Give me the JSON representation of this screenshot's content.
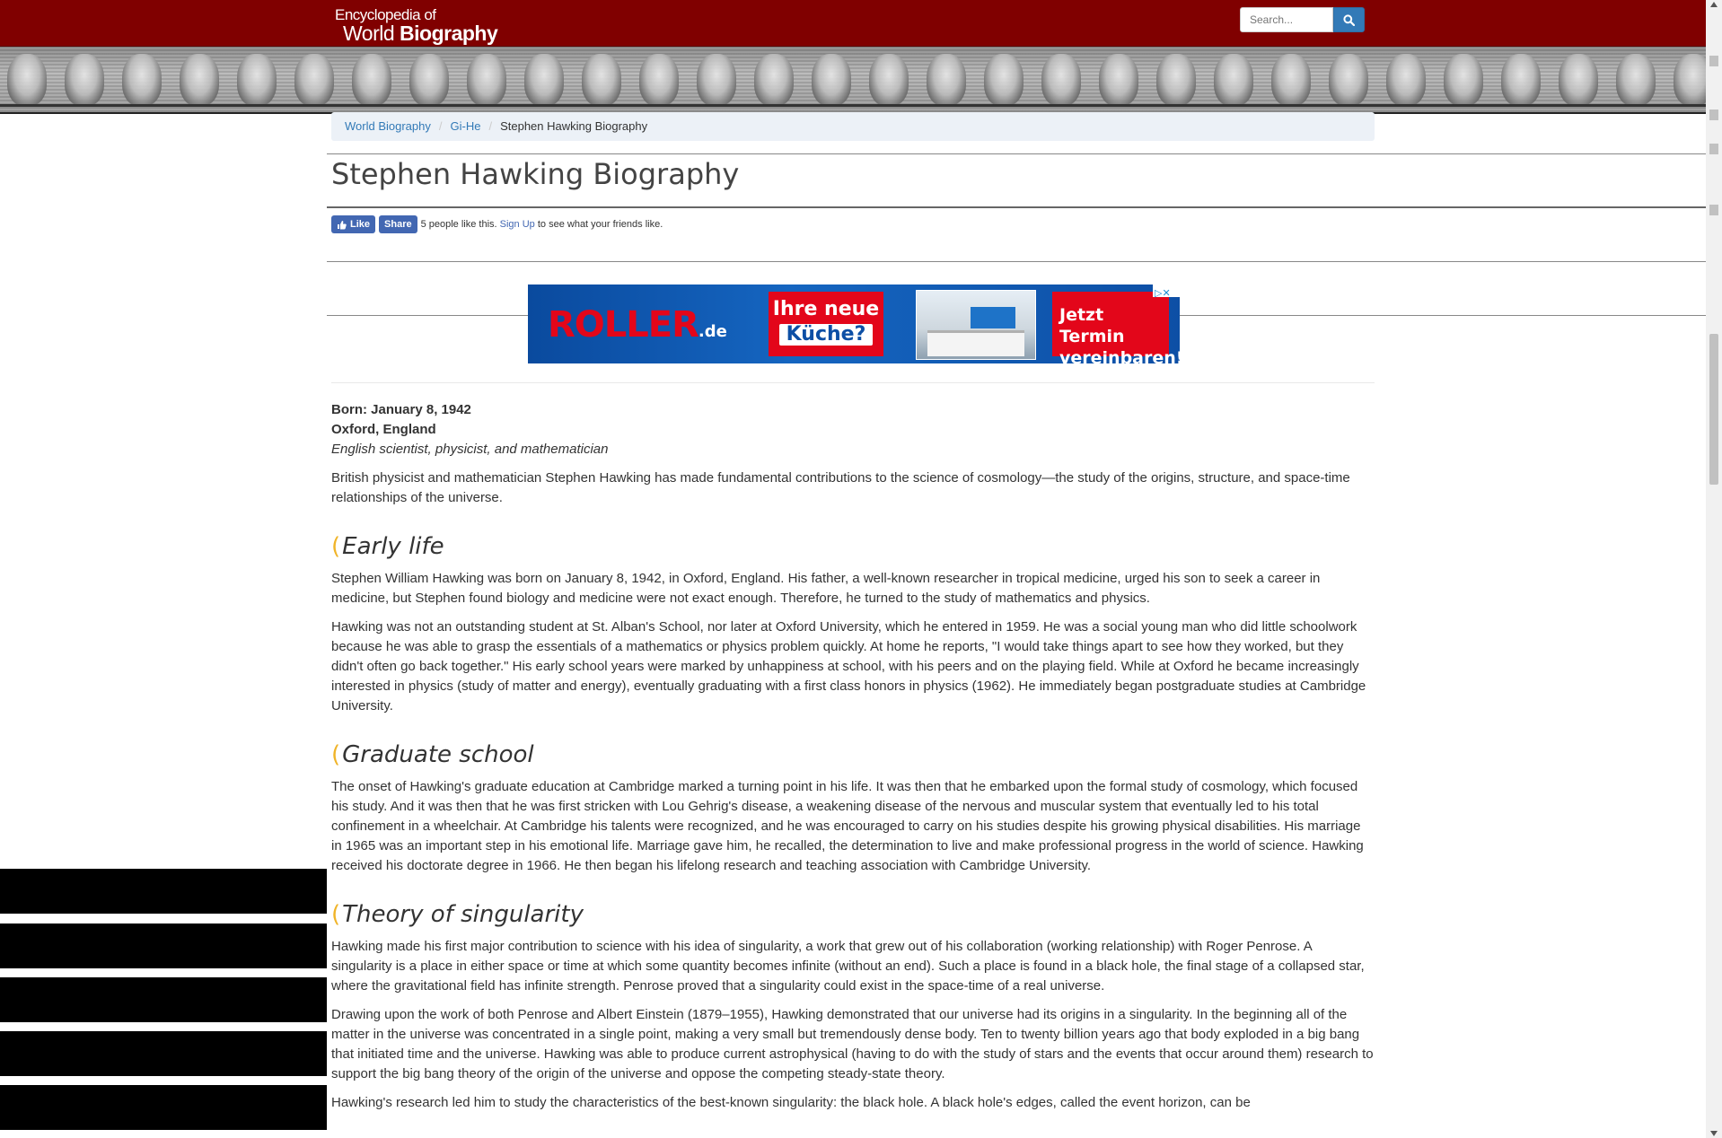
{
  "header": {
    "logo_line1": "Encyclopedia of",
    "logo_line2_a": "World ",
    "logo_line2_b": "Biography",
    "search_placeholder": "Search...",
    "colors": {
      "bar": "#800000",
      "search_button": "#337ab7"
    }
  },
  "breadcrumb": {
    "items": [
      "World Biography",
      "Gi-He"
    ],
    "current": "Stephen Hawking Biography"
  },
  "page": {
    "title": "Stephen Hawking Biography"
  },
  "facebook": {
    "like": "Like",
    "share": "Share",
    "count_text": "5 people like this.",
    "signup": "Sign Up",
    "signup_suffix": "to see what your friends like."
  },
  "ad": {
    "brand": "ROLLER",
    "brand_tld": ".de",
    "promo_line1": "Ihre neue",
    "promo_line2": "Küche?",
    "cta_line1": "Jetzt Termin",
    "cta_line2": "vereinbaren!"
  },
  "article": {
    "born": "Born: January 8, 1942",
    "birthplace": "Oxford, England",
    "role": "English scientist, physicist, and mathematician",
    "intro": "British physicist and mathematician Stephen Hawking has made fundamental contributions to the science of cosmology—the study of the origins, structure, and space-time relationships of the universe.",
    "sections": [
      {
        "heading": "Early life",
        "paragraphs": [
          "Stephen William Hawking was born on January 8, 1942, in Oxford, England. His father, a well-known researcher in tropical medicine, urged his son to seek a career in medicine, but Stephen found biology and medicine were not exact enough. Therefore, he turned to the study of mathematics and physics.",
          "Hawking was not an outstanding student at St. Alban's School, nor later at Oxford University, which he entered in 1959. He was a social young man who did little schoolwork because he was able to grasp the essentials of a mathematics or physics problem quickly. At home he reports, \"I would take things apart to see how they worked, but they didn't often go back together.\" His early school years were marked by unhappiness at school, with his peers and on the playing field. While at Oxford he became increasingly interested in physics (study of matter and energy), eventually graduating with a first class honors in physics (1962). He immediately began postgraduate studies at Cambridge University."
        ]
      },
      {
        "heading": "Graduate school",
        "paragraphs": [
          "The onset of Hawking's graduate education at Cambridge marked a turning point in his life. It was then that he embarked upon the formal study of cosmology, which focused his study. And it was then that he was first stricken with Lou Gehrig's disease, a weakening disease of the nervous and muscular system that eventually led to his total confinement in a wheelchair. At Cambridge his talents were recognized, and he was encouraged to carry on his studies despite his growing physical disabilities. His marriage in 1965 was an important step in his emotional life. Marriage gave him, he recalled, the determination to live and make professional progress in the world of science. Hawking received his doctorate degree in 1966. He then began his lifelong research and teaching association with Cambridge University."
        ]
      },
      {
        "heading": "Theory of singularity",
        "paragraphs": [
          "Hawking made his first major contribution to science with his idea of singularity, a work that grew out of his collaboration (working relationship) with Roger Penrose. A singularity is a place in either space or time at which some quantity becomes infinite (without an end). Such a place is found in a black hole, the final stage of a collapsed star, where the gravitational field has infinite strength. Penrose proved that a singularity could exist in the space-time of a real universe.",
          "Drawing upon the work of both Penrose and Albert Einstein (1879–1955), Hawking demonstrated that our universe had its origins in a singularity. In the beginning all of the matter in the universe was concentrated in a single point, making a very small but tremendously dense body. Ten to twenty billion years ago that body exploded in a big bang that initiated time and the universe. Hawking was able to produce current astrophysical (having to do with the study of stars and the events that occur around them) research to support the big bang theory of the origin of the universe and oppose the competing steady-state theory.",
          "Hawking's research led him to study the characteristics of the best-known singularity: the black hole. A black hole's edges, called the event horizon, can be"
        ]
      }
    ]
  }
}
